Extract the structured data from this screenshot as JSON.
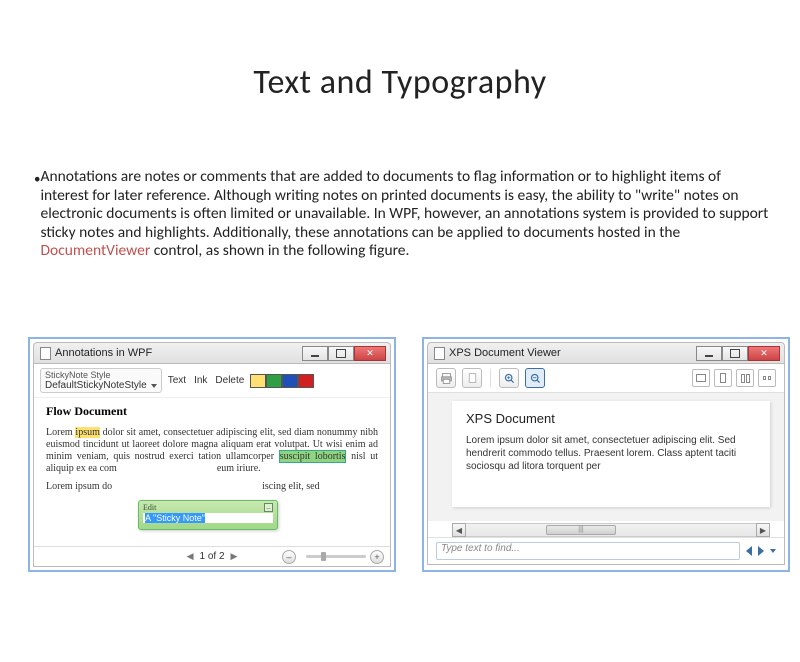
{
  "title": "Text and Typography",
  "body_text_a": "Annotations are notes or comments that are added to documents to flag information or to highlight items of interest for later reference. Although writing notes on printed documents is easy, the ability to \"write\" notes on electronic documents is often limited or unavailable. In WPF, however, an annotations system is provided to support sticky notes and highlights. Additionally, these annotations can be applied to documents hosted in the ",
  "body_link": "DocumentViewer",
  "body_text_b": " control, as shown in the following figure.",
  "win1": {
    "title": "Annotations in WPF",
    "style_label": "StickyNote Style",
    "style_value": "DefaultStickyNoteStyle",
    "btn_text": "Text",
    "btn_ink": "Ink",
    "btn_delete": "Delete",
    "swatches": [
      "#ffe070",
      "#2ea043",
      "#1f4fb8",
      "#d02020"
    ],
    "heading": "Flow Document",
    "p1a": "Lorem ",
    "p1hl": "ipsum",
    "p1b": " dolor sit amet, consectetuer adipiscing elit, sed diam nonummy nibh euismod tincidunt ut laoreet dolore magna aliquam erat volutpat. Ut wisi enim ad minim veniam, quis nostrud exerci tation ullamcorper ",
    "p1hl2": "suscipit lobortis",
    "p1c": " nisl ut aliquip ex ea com",
    "p1d": "eum iriure.",
    "p2a": "Lorem ipsum do",
    "p2b": "iscing elit, sed",
    "sticky_label": "Edit",
    "sticky_text": "A \"Sticky Note\"",
    "pager": "1 of 2"
  },
  "win2": {
    "title": "XPS Document Viewer",
    "heading": "XPS Document",
    "para": "Lorem ipsum dolor sit amet, consectetuer adipiscing elit. Sed hendrerit commodo tellus. Praesent lorem. Class aptent taciti sociosqu ad litora torquent per",
    "scroll_thumb": "|||",
    "search_placeholder": "Type text to find..."
  }
}
